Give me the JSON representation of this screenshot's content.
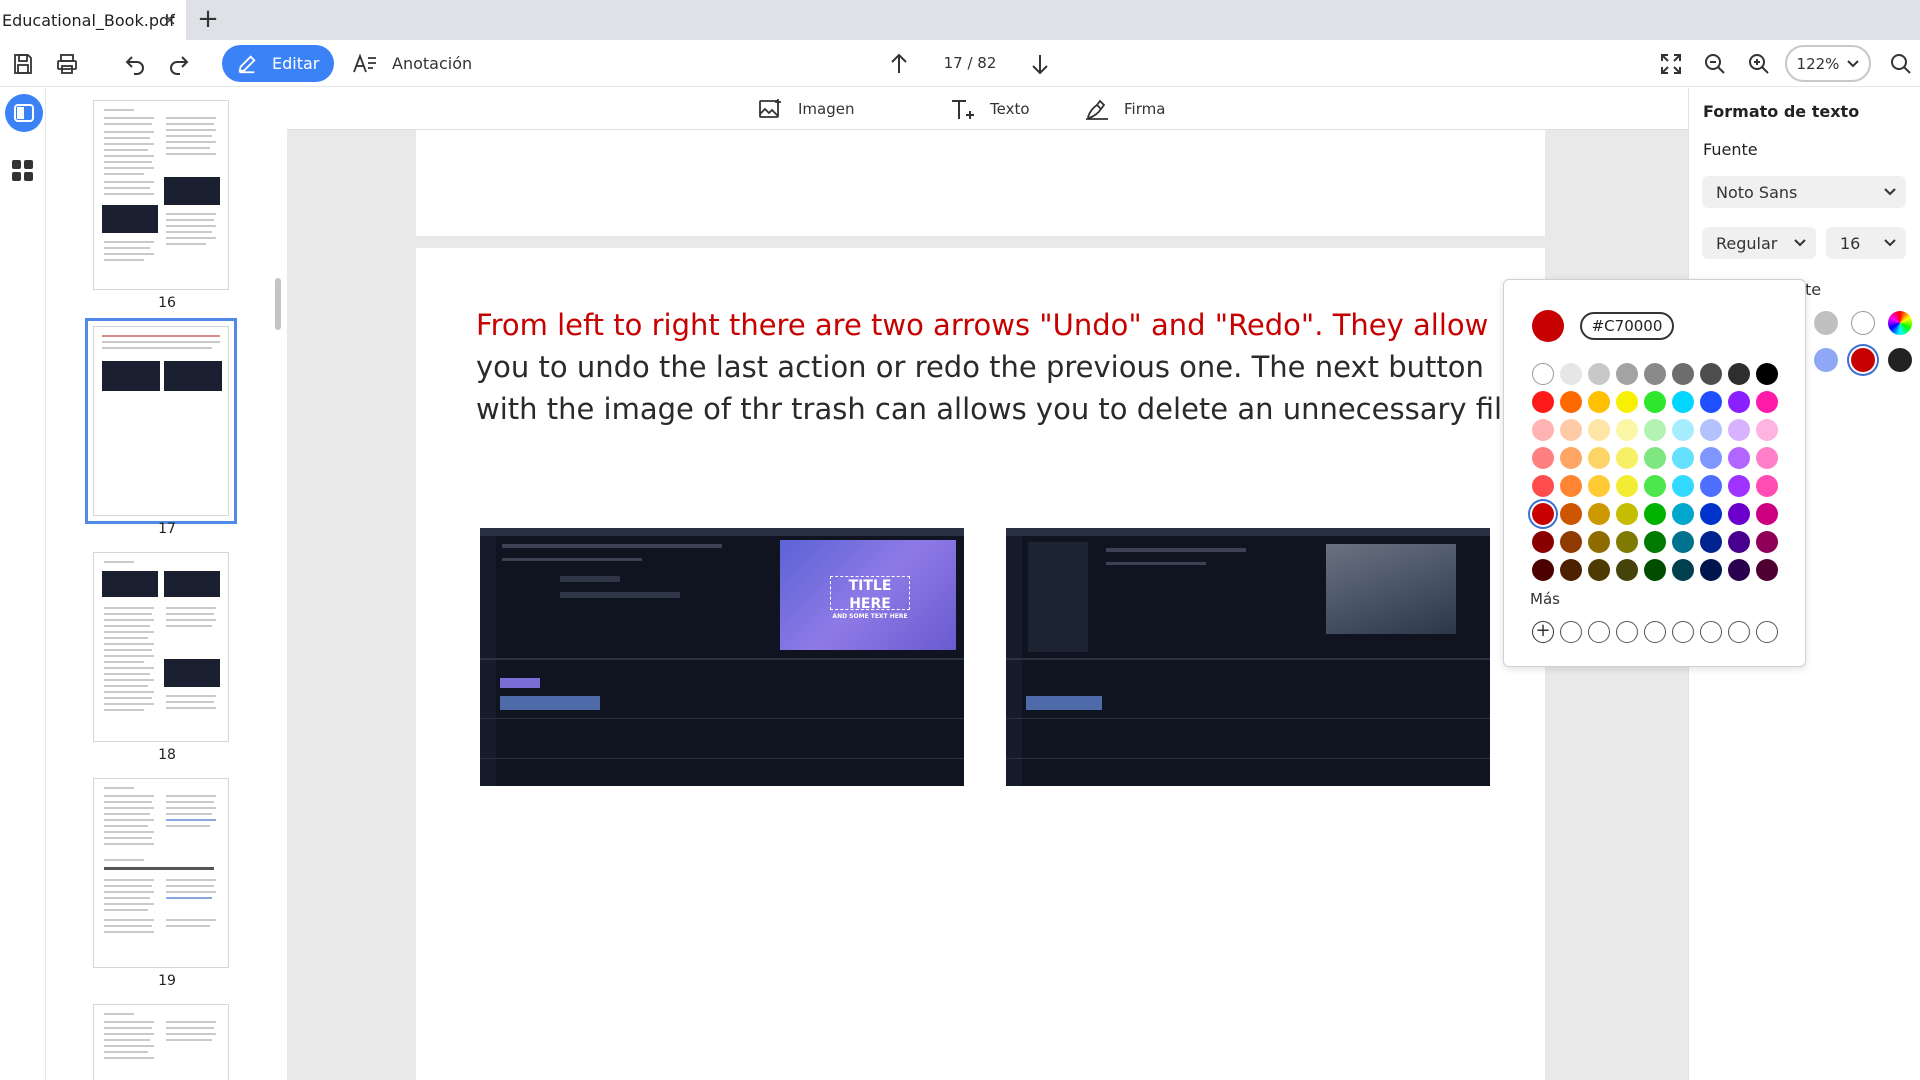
{
  "tabs": [
    {
      "title": "Educational_Book.pdf",
      "close": "×"
    }
  ],
  "tab_new": "+",
  "toolbar": {
    "edit_label": "Editar",
    "annotation_label": "Anotación",
    "page_indicator": "17 / 82",
    "zoom": "122%"
  },
  "subtoolbar": {
    "image": "Imagen",
    "text": "Texto",
    "signature": "Firma"
  },
  "thumbnails": [
    {
      "number": "16"
    },
    {
      "number": "17"
    },
    {
      "number": "18"
    },
    {
      "number": "19"
    }
  ],
  "page": {
    "text_red": "From left to right there are two arrows \"Undo\" and \"Redo\". They allow",
    "text_line2": "you to undo the last action or redo the previous one. The next button",
    "text_line3": "with the image of thr trash can allows you to delete an unnecessary file.",
    "screenshot1_overlay_title": "TITLE HERE",
    "screenshot1_overlay_sub": "AND SOME TEXT HERE"
  },
  "format_panel": {
    "title": "Formato de texto",
    "font_label": "Fuente",
    "font_family": "Noto Sans",
    "font_style": "Regular",
    "font_size": "16",
    "partial_label": "te",
    "swatches": [
      "#c0c0c0",
      "#ffffff",
      "#8fa8f5",
      "#c70000",
      "#222222"
    ]
  },
  "color_picker": {
    "current_color": "#C70000",
    "more_label": "Más",
    "rows": [
      [
        "#ffffff",
        "#e6e6e6",
        "#c8c8c8",
        "#a3a3a3",
        "#898989",
        "#6d6d6d",
        "#4d4d4d",
        "#2e2e2e",
        "#000000"
      ],
      [
        "#ff1a1a",
        "#ff6a00",
        "#ffc000",
        "#f7f000",
        "#2ee62e",
        "#00d6ff",
        "#1f4fff",
        "#8a1fff",
        "#ff1aa8"
      ],
      [
        "#ffb3b3",
        "#ffcba6",
        "#ffe6a6",
        "#fbf7a6",
        "#b3f2b3",
        "#a6eeff",
        "#b3c2ff",
        "#d7b3ff",
        "#ffb3e0"
      ],
      [
        "#ff8080",
        "#ffa566",
        "#ffd466",
        "#f7f066",
        "#80e680",
        "#66e0ff",
        "#7f96ff",
        "#b366ff",
        "#ff80c8"
      ],
      [
        "#ff4d4d",
        "#ff8533",
        "#ffca33",
        "#f2ec33",
        "#4de64d",
        "#33d9ff",
        "#4d6eff",
        "#9f33ff",
        "#ff4db3"
      ],
      [
        "#c70000",
        "#cc5500",
        "#cc9900",
        "#c4bd00",
        "#00b300",
        "#00a7cc",
        "#0033cc",
        "#6b00cc",
        "#cc0080"
      ],
      [
        "#8a0000",
        "#8f3b00",
        "#8f6b00",
        "#7f7a00",
        "#007a00",
        "#00728f",
        "#00238f",
        "#4a008f",
        "#8f0059"
      ],
      [
        "#4d0000",
        "#4d2000",
        "#4d3a00",
        "#45420a",
        "#004d00",
        "#003f4d",
        "#00144d",
        "#29004d",
        "#4d0031"
      ]
    ],
    "selected": "#c70000"
  }
}
